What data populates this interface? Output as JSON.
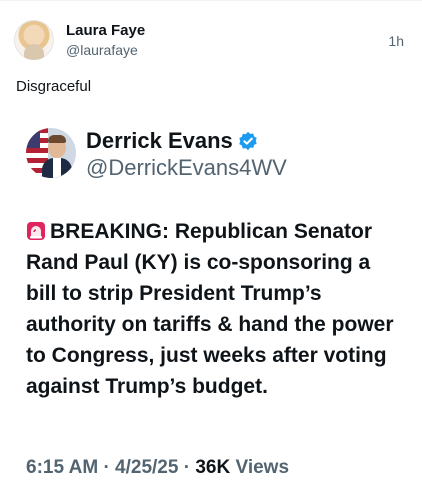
{
  "post": {
    "author_name": "Laura Faye",
    "author_handle": "@laurafaye",
    "time": "1h",
    "text": "Disgraceful"
  },
  "quoted": {
    "author_name": "Derrick Evans",
    "author_handle": "@DerrickEvans4WV",
    "verified": true,
    "body": "BREAKING: Republican Senator Rand Paul (KY) is co-sponsoring a bill to strip President Trump’s authority on tariffs & hand the power to Congress, just weeks after voting against Trump’s budget.",
    "emoji_icon": "siren-icon",
    "time": "6:15 AM",
    "date": "4/25/25",
    "views_count": "36K",
    "views_label": "Views",
    "separator": "·"
  },
  "colors": {
    "text": "#0f1419",
    "secondary": "#536471",
    "verified": "#1d9bf0",
    "siren": "#e0245e"
  }
}
